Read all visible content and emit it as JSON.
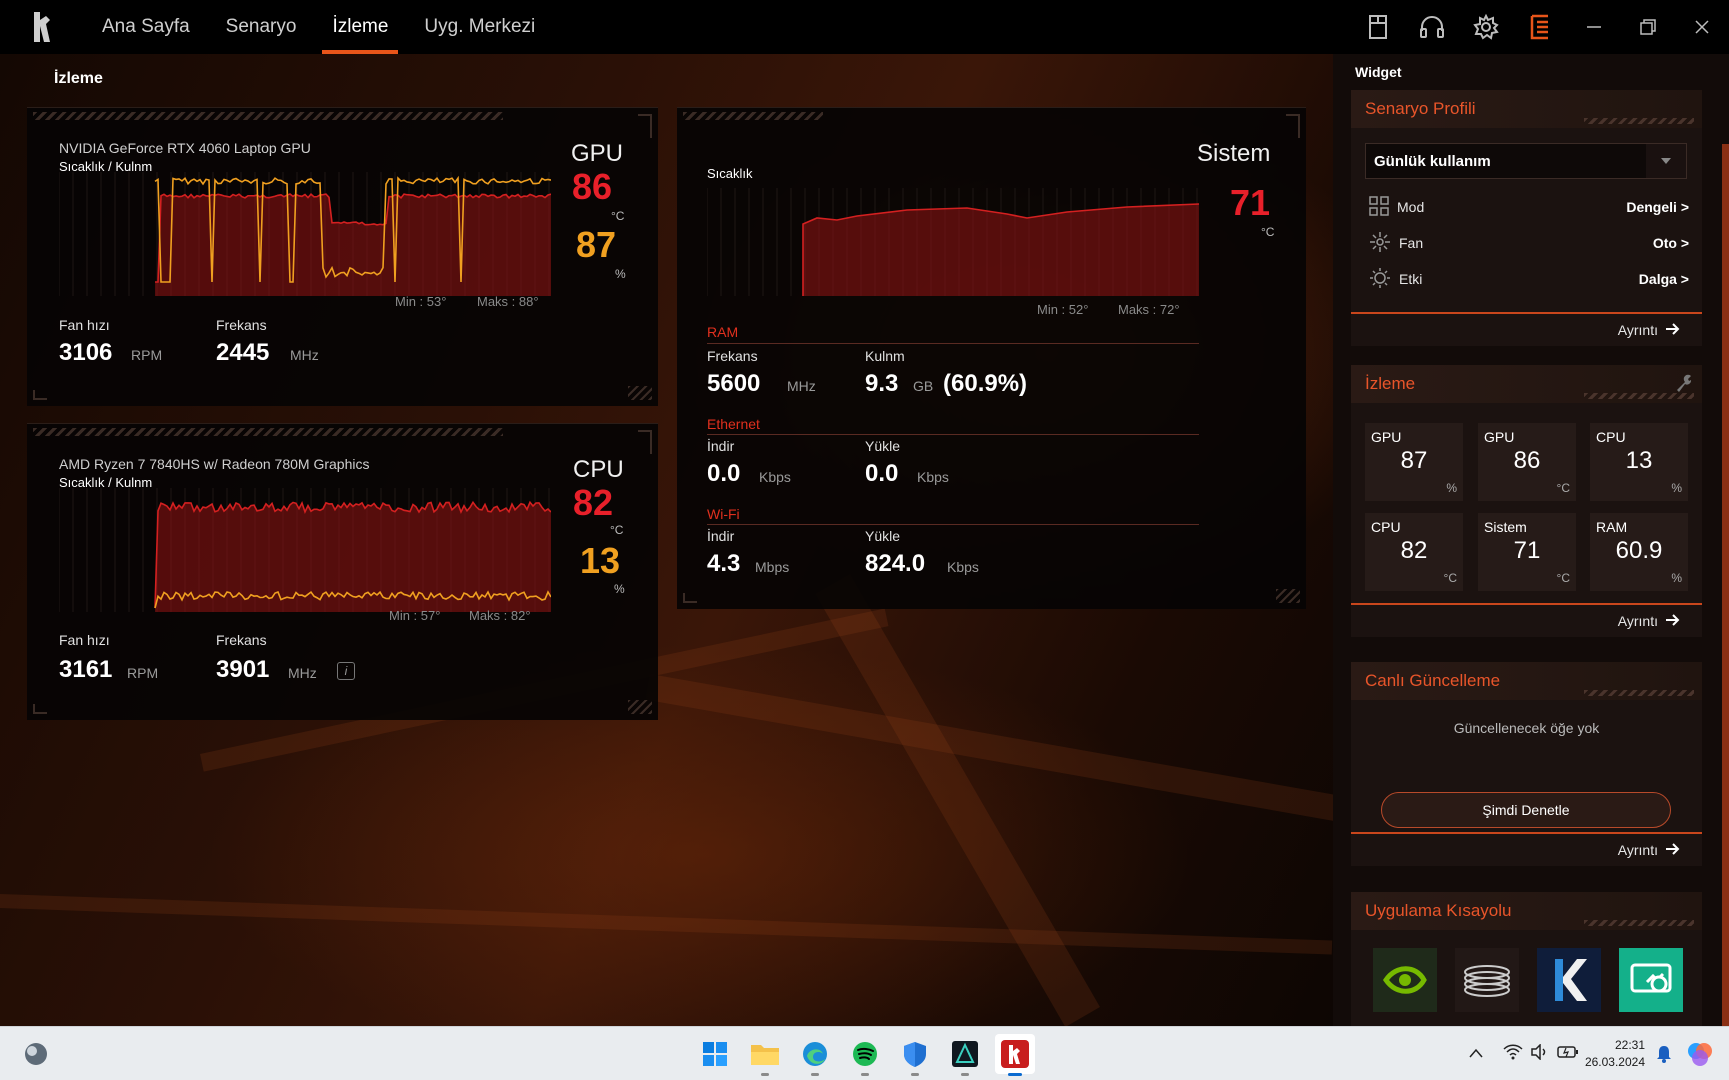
{
  "nav": {
    "tabs": [
      {
        "label": "Ana Sayfa"
      },
      {
        "label": "Senaryo"
      },
      {
        "label": "İzleme"
      },
      {
        "label": "Uyg. Merkezi"
      }
    ]
  },
  "page": {
    "title": "İzleme"
  },
  "gpu": {
    "name": "NVIDIA GeForce RTX 4060 Laptop GPU",
    "sub": "Sıcaklık / Kulnm",
    "type": "GPU",
    "temp": "86",
    "temp_unit": "°C",
    "usage": "87",
    "usage_unit": "%",
    "min": "Min : 53°",
    "max": "Maks : 88°",
    "fan_label": "Fan hızı",
    "fan": "3106",
    "fan_unit": "RPM",
    "freq_label": "Frekans",
    "freq": "2445",
    "freq_unit": "MHz"
  },
  "cpu": {
    "name": "AMD Ryzen 7 7840HS w/ Radeon 780M Graphics",
    "sub": "Sıcaklık / Kulnm",
    "type": "CPU",
    "temp": "82",
    "temp_unit": "°C",
    "usage": "13",
    "usage_unit": "%",
    "min": "Min : 57°",
    "max": "Maks : 82°",
    "fan_label": "Fan hızı",
    "fan": "3161",
    "fan_unit": "RPM",
    "freq_label": "Frekans",
    "freq": "3901",
    "freq_unit": "MHz",
    "info_icon": "i"
  },
  "system": {
    "type": "Sistem",
    "temp_label": "Sıcaklık",
    "temp": "71",
    "temp_unit": "°C",
    "min": "Min : 52°",
    "max": "Maks : 72°",
    "ram": {
      "head": "RAM",
      "freq_label": "Frekans",
      "freq": "5600",
      "freq_unit": "MHz",
      "used_label": "Kulnm",
      "used": "9.3",
      "used_unit": "GB",
      "used_pct": "(60.9%)"
    },
    "ethernet": {
      "head": "Ethernet",
      "down_label": "İndir",
      "down": "0.0",
      "down_unit": "Kbps",
      "up_label": "Yükle",
      "up": "0.0",
      "up_unit": "Kbps"
    },
    "wifi": {
      "head": "Wi-Fi",
      "down_label": "İndir",
      "down": "4.3",
      "down_unit": "Mbps",
      "up_label": "Yükle",
      "up": "824.0",
      "up_unit": "Kbps"
    }
  },
  "sidebar": {
    "title": "Widget",
    "profile": {
      "head": "Senaryo Profili",
      "selected": "Günlük kullanım",
      "rows": [
        {
          "label": "Mod",
          "value": "Dengeli >"
        },
        {
          "label": "Fan",
          "value": "Oto >"
        },
        {
          "label": "Etki",
          "value": "Dalga >"
        }
      ],
      "details": "Ayrıntı"
    },
    "monitor": {
      "head": "İzleme",
      "tiles": [
        {
          "name": "GPU",
          "value": "87",
          "unit": "%"
        },
        {
          "name": "GPU",
          "value": "86",
          "unit": "°C"
        },
        {
          "name": "CPU",
          "value": "13",
          "unit": "%"
        },
        {
          "name": "CPU",
          "value": "82",
          "unit": "°C"
        },
        {
          "name": "Sistem",
          "value": "71",
          "unit": "°C"
        },
        {
          "name": "RAM",
          "value": "60.9",
          "unit": "%"
        }
      ],
      "details": "Ayrıntı"
    },
    "update": {
      "head": "Canlı Güncelleme",
      "empty": "Güncellenecek öğe yok",
      "button": "Şimdi Denetle",
      "details": "Ayrıntı"
    },
    "shortcuts": {
      "head": "Uygulama Kısayolu"
    }
  },
  "taskbar": {
    "time": "22:31",
    "date": "26.03.2024"
  },
  "colors": {
    "accent": "#e8551a",
    "temp_red": "#e8202a",
    "usage_orange": "#f0a020",
    "panel_bg": "#060404"
  }
}
